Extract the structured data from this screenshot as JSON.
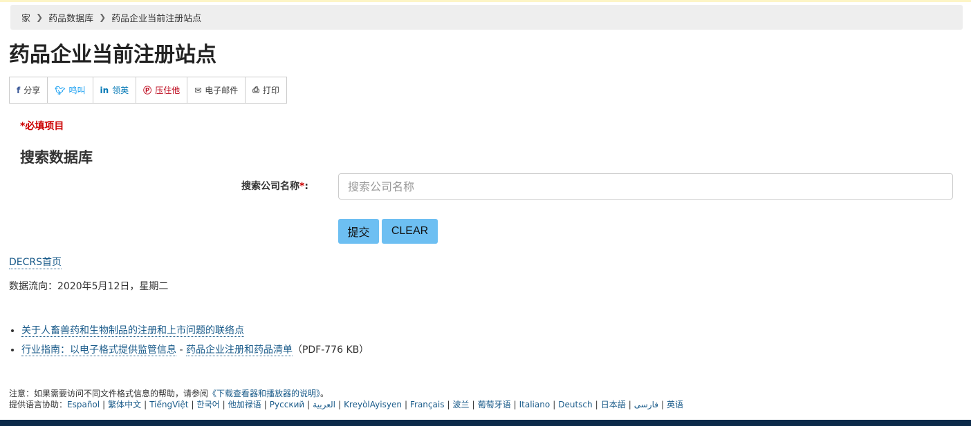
{
  "breadcrumb": {
    "home": "家",
    "database": "药品数据库",
    "current": "药品企业当前注册站点"
  },
  "page_title": "药品企业当前注册站点",
  "share": {
    "facebook": "分享",
    "twitter": "鸣叫",
    "linkedin": "领英",
    "pinterest": "压住他",
    "email": "电子邮件",
    "print": "打印"
  },
  "form": {
    "required_note": "*必填项目",
    "heading": "搜索数据库",
    "label": "搜索公司名称",
    "required_mark": "*",
    "colon": ":",
    "placeholder": "搜索公司名称",
    "submit": "提交",
    "clear": "CLEAR"
  },
  "home_link": "DECRS首页",
  "data_flow": "数据流向：2020年5月12日，星期二",
  "resources": [
    {
      "link": "关于人畜兽药和生物制品的注册和上市问题的联络点"
    },
    {
      "link": "行业指南：以电子格式提供监管信息",
      "dash": " - ",
      "link2": "药品企业注册和药品清单",
      "suffix": "（PDF-776 KB）"
    }
  ],
  "footer": {
    "note_prefix": "注意：如果需要访问不同文件格式信息的帮助，请参阅",
    "note_link": "《下载查看器和播放器的说明》",
    "note_suffix": "。",
    "lang_prefix": "提供语言协助：",
    "languages": [
      "Español",
      "繁体中文",
      "TiếngViệt",
      "한국어",
      "他加禄语",
      "Русский",
      "العربية",
      "KreyòlAyisyen",
      "Français",
      "波兰",
      "葡萄牙语",
      "Italiano",
      "Deutsch",
      "日本語",
      "فارسی",
      "英语"
    ]
  }
}
